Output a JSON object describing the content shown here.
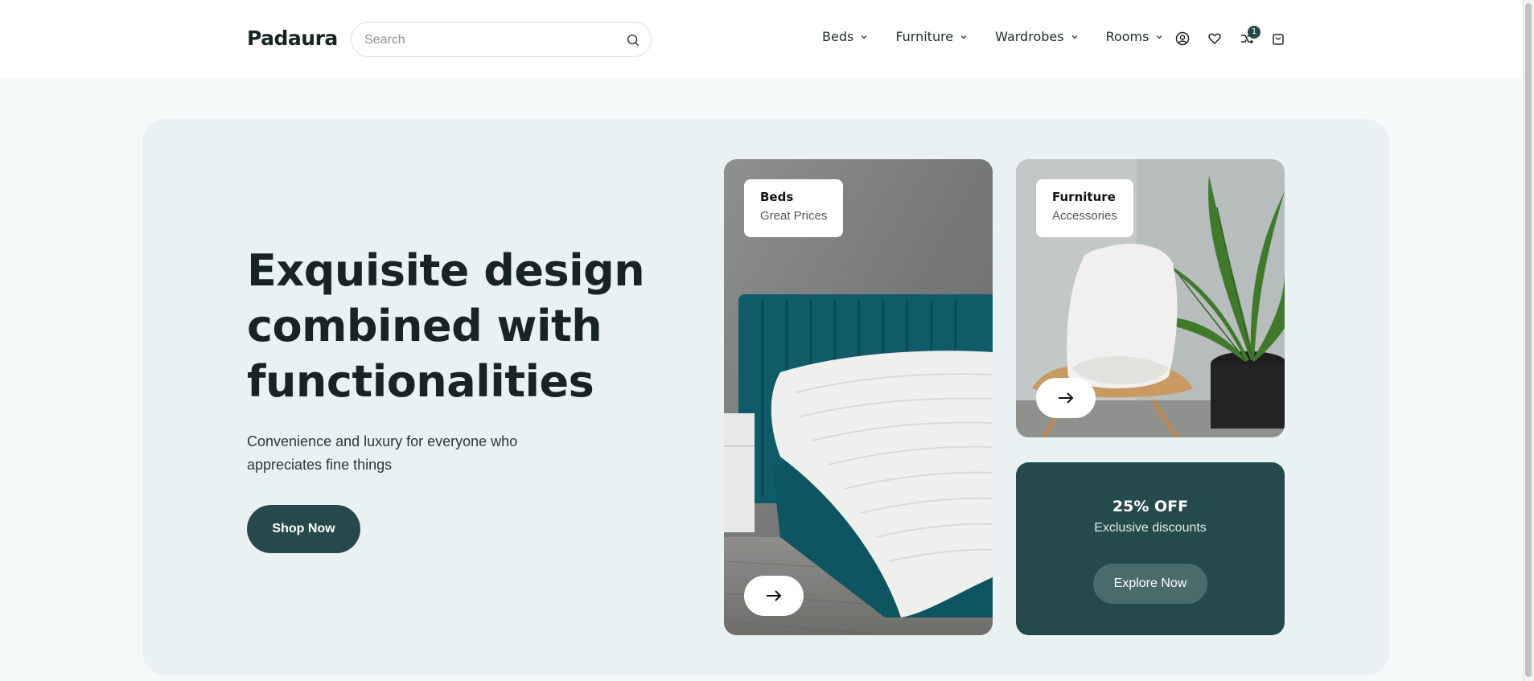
{
  "brand": {
    "name": "Padaura"
  },
  "search": {
    "placeholder": "Search"
  },
  "nav": [
    {
      "label": "Beds"
    },
    {
      "label": "Furniture"
    },
    {
      "label": "Wardrobes"
    },
    {
      "label": "Rooms"
    }
  ],
  "header_icons": [
    "user-icon",
    "heart-icon",
    "compare-icon",
    "cart-icon"
  ],
  "compare_count": "1",
  "hero": {
    "headline": "Exquisite design combined with functionalities",
    "subtitle": "Convenience and luxury for everyone who appreciates fine things",
    "cta": "Shop Now"
  },
  "cards": {
    "beds": {
      "title": "Beds",
      "subtitle": "Great Prices"
    },
    "furniture": {
      "title": "Furniture",
      "subtitle": "Accessories"
    },
    "promo": {
      "title": "25% OFF",
      "subtitle": "Exclusive discounts",
      "cta": "Explore Now"
    }
  },
  "colors": {
    "accent": "#264a4c",
    "hero_bg": "#eaf1f2",
    "page_bg": "#f6f9f9"
  }
}
